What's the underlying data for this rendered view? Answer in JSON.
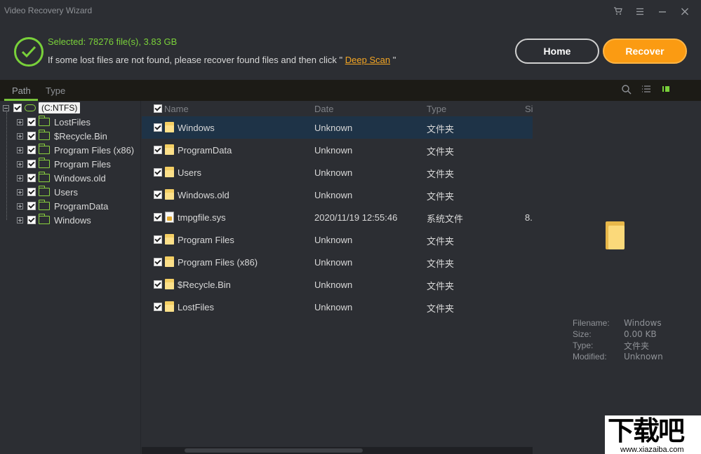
{
  "window": {
    "title": "Video Recovery Wizard",
    "controls": [
      "cart-icon",
      "menu-icon",
      "minimize-icon",
      "close-icon"
    ]
  },
  "status": {
    "selected": "Selected: 78276 file(s), 3.83 GB",
    "hint_prefix": "If some lost files are not found, please recover found files and then click \"",
    "deep_scan_link": "Deep Scan",
    "hint_suffix": "\"",
    "accent_color": "#79d13a"
  },
  "buttons": {
    "home": "Home",
    "recover": "Recover",
    "recover_color": "#fb9b12"
  },
  "tabs": [
    {
      "label": "Path",
      "active": true
    },
    {
      "label": "Type",
      "active": false
    }
  ],
  "tree": {
    "root": "(C:NTFS)",
    "children": [
      "LostFiles",
      "$Recycle.Bin",
      "Program Files (x86)",
      "Program Files",
      "Windows.old",
      "Users",
      "ProgramData",
      "Windows"
    ]
  },
  "list": {
    "columns": {
      "name": "Name",
      "date": "Date",
      "type": "Type",
      "size": "Si"
    },
    "rows": [
      {
        "name": "Windows",
        "date": "Unknown",
        "type": "文件夹",
        "size": "",
        "icon": "folder",
        "selected": true
      },
      {
        "name": "ProgramData",
        "date": "Unknown",
        "type": "文件夹",
        "size": "",
        "icon": "folder",
        "selected": false
      },
      {
        "name": "Users",
        "date": "Unknown",
        "type": "文件夹",
        "size": "",
        "icon": "folder",
        "selected": false
      },
      {
        "name": "Windows.old",
        "date": "Unknown",
        "type": "文件夹",
        "size": "",
        "icon": "folder",
        "selected": false
      },
      {
        "name": "tmpgfile.sys",
        "date": "2020/11/19 12:55:46",
        "type": "系统文件",
        "size": "8.",
        "icon": "system-file",
        "selected": false
      },
      {
        "name": "Program Files",
        "date": "Unknown",
        "type": "文件夹",
        "size": "",
        "icon": "folder",
        "selected": false
      },
      {
        "name": "Program Files (x86)",
        "date": "Unknown",
        "type": "文件夹",
        "size": "",
        "icon": "folder",
        "selected": false
      },
      {
        "name": "$Recycle.Bin",
        "date": "Unknown",
        "type": "文件夹",
        "size": "",
        "icon": "folder",
        "selected": false
      },
      {
        "name": "LostFiles",
        "date": "Unknown",
        "type": "文件夹",
        "size": "",
        "icon": "folder",
        "selected": false
      }
    ]
  },
  "preview": {
    "filename_label": "Filename:",
    "filename": "Windows",
    "size_label": "Size:",
    "size": "0.00 KB",
    "type_label": "Type:",
    "type": "文件夹",
    "modified_label": "Modified:",
    "modified": "Unknown"
  },
  "watermark": {
    "text": "下载吧",
    "url": "www.xiazaiba.com"
  }
}
